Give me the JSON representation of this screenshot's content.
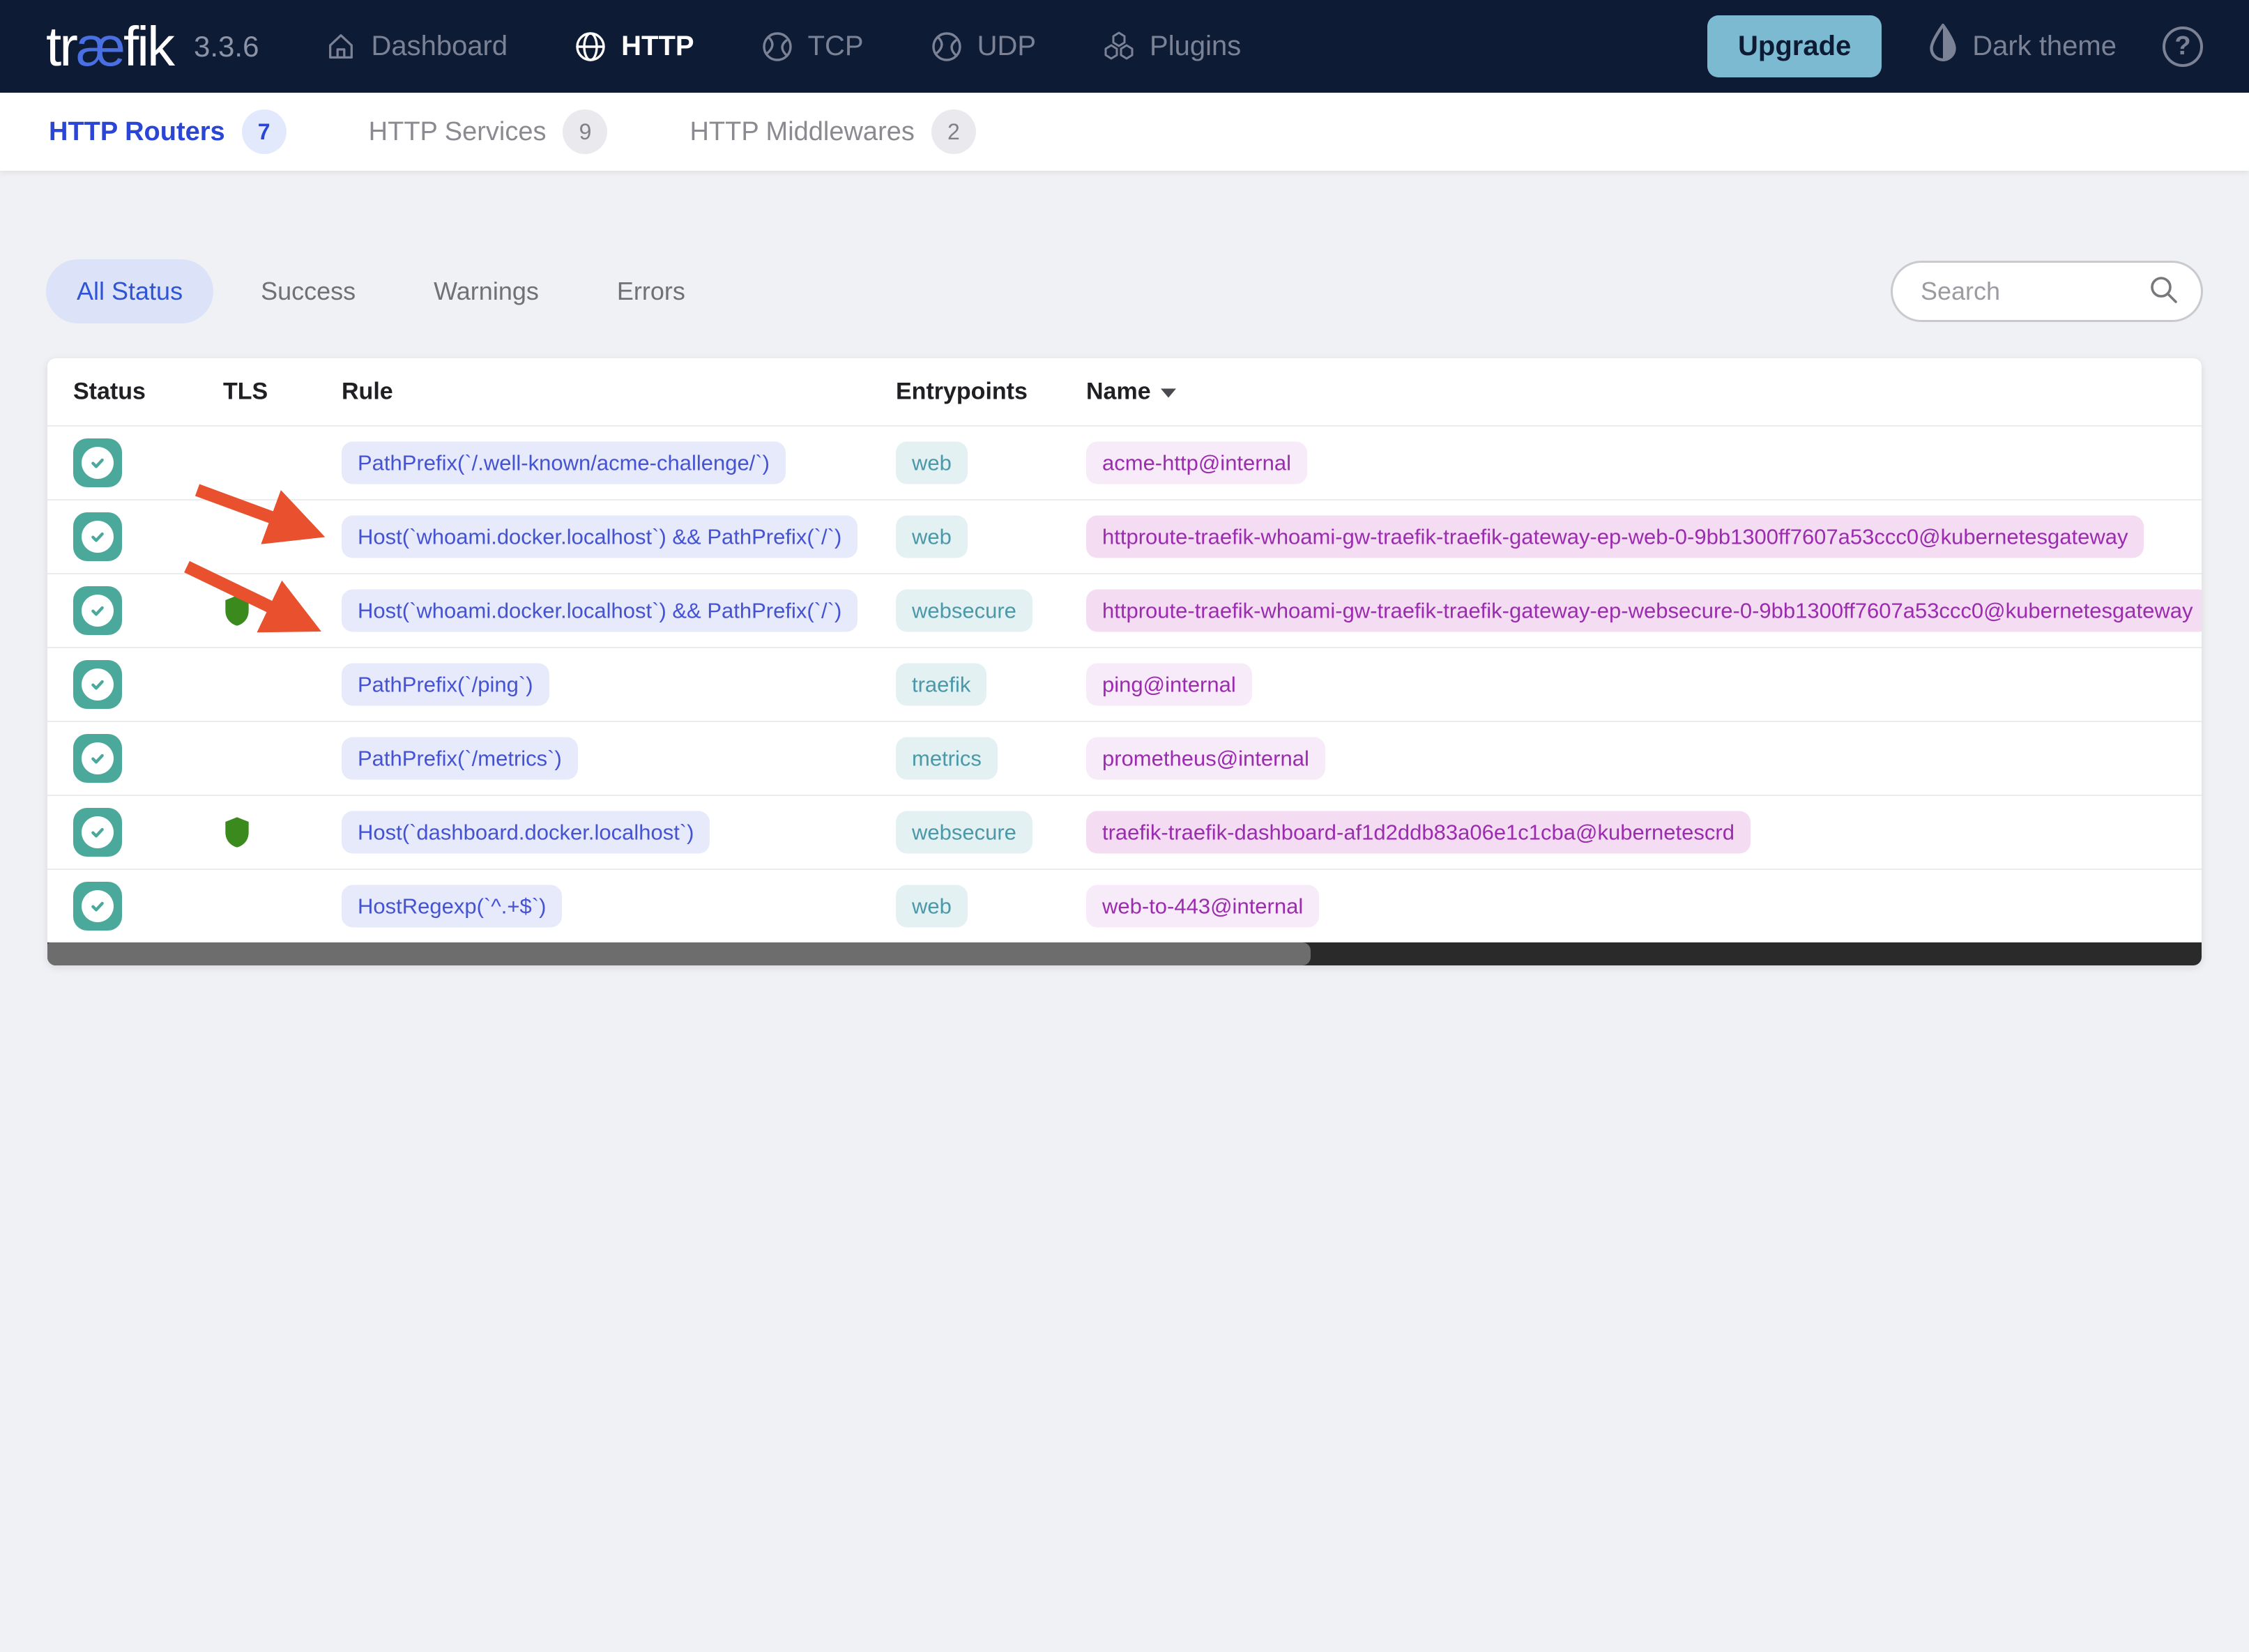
{
  "navbar": {
    "logo": {
      "prefix": "tr",
      "ligature": "æ",
      "suffix": "fik"
    },
    "version": "3.3.6",
    "items": [
      {
        "label": "Dashboard"
      },
      {
        "label": "HTTP"
      },
      {
        "label": "TCP"
      },
      {
        "label": "UDP"
      },
      {
        "label": "Plugins"
      }
    ],
    "upgrade_label": "Upgrade",
    "theme_label": "Dark theme",
    "help_glyph": "?"
  },
  "tabs": [
    {
      "label": "HTTP Routers",
      "count": "7"
    },
    {
      "label": "HTTP Services",
      "count": "9"
    },
    {
      "label": "HTTP Middlewares",
      "count": "2"
    }
  ],
  "filters": {
    "all": "All Status",
    "success": "Success",
    "warnings": "Warnings",
    "errors": "Errors"
  },
  "search": {
    "placeholder": "Search"
  },
  "table": {
    "columns": {
      "status": "Status",
      "tls": "TLS",
      "rule": "Rule",
      "entrypoints": "Entrypoints",
      "name": "Name"
    },
    "rows": [
      {
        "status": "success",
        "tls": false,
        "rule": "PathPrefix(`/.well-known/acme-challenge/`)",
        "entrypoint": "web",
        "name": "acme-http@internal"
      },
      {
        "status": "success",
        "tls": false,
        "rule": "Host(`whoami.docker.localhost`) && PathPrefix(`/`)",
        "entrypoint": "web",
        "name": "httproute-traefik-whoami-gw-traefik-traefik-gateway-ep-web-0-9bb1300ff7607a53ccc0@kubernetesgateway"
      },
      {
        "status": "success",
        "tls": true,
        "rule": "Host(`whoami.docker.localhost`) && PathPrefix(`/`)",
        "entrypoint": "websecure",
        "name": "httproute-traefik-whoami-gw-traefik-traefik-gateway-ep-websecure-0-9bb1300ff7607a53ccc0@kubernetesgateway"
      },
      {
        "status": "success",
        "tls": false,
        "rule": "PathPrefix(`/ping`)",
        "entrypoint": "traefik",
        "name": "ping@internal"
      },
      {
        "status": "success",
        "tls": false,
        "rule": "PathPrefix(`/metrics`)",
        "entrypoint": "metrics",
        "name": "prometheus@internal"
      },
      {
        "status": "success",
        "tls": true,
        "rule": "Host(`dashboard.docker.localhost`)",
        "entrypoint": "websecure",
        "name": "traefik-traefik-dashboard-af1d2ddb83a06e1c1cba@kubernetescrd"
      },
      {
        "status": "success",
        "tls": false,
        "rule": "HostRegexp(`^.+$`)",
        "entrypoint": "web",
        "name": "web-to-443@internal"
      }
    ]
  },
  "colors": {
    "navbar_bg": "#0d1b35",
    "accent_blue": "#2b46d4",
    "upgrade_bg": "#7cbad2",
    "status_teal": "#4ba99b",
    "tls_green": "#3a8a1e",
    "rule_text": "#4553d3",
    "entrypoint_text": "#4a98a8",
    "name_text": "#9c2caf",
    "arrow_red": "#e8502e"
  }
}
